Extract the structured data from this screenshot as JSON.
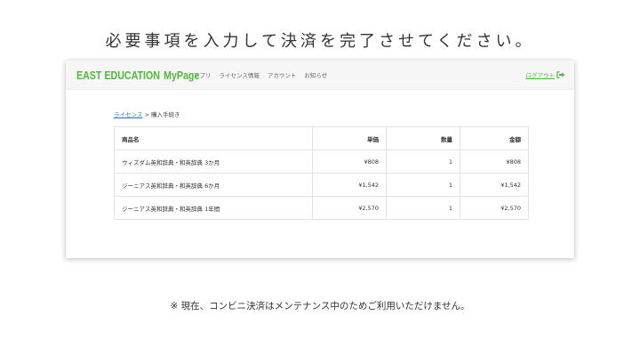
{
  "headline": "必要事項を入力して決済を完了させてください。",
  "header": {
    "brand_main": "EAST EDUCATION",
    "brand_sub": "MyPage",
    "nav": [
      "アプリ",
      "ライセンス情報",
      "アカウント",
      "お知らせ"
    ],
    "logout_label": "ログアウト",
    "logout_icon": "sign-out-icon",
    "brand_color": "#4dba3a"
  },
  "breadcrumb": {
    "link": "ライセンス",
    "separator": ">",
    "current": "購入手続き"
  },
  "table": {
    "headers": [
      "商品名",
      "単価",
      "数量",
      "金額"
    ],
    "rows": [
      [
        "ウィズダム英和辞典・和英辞典 3か月",
        "¥808",
        "1",
        "¥808"
      ],
      [
        "ジーニアス英和辞典・和英辞典 6か月",
        "¥1,542",
        "1",
        "¥1,542"
      ],
      [
        "ジーニアス英和辞典・和英辞典 1年間",
        "¥2,570",
        "1",
        "¥2,570"
      ]
    ]
  },
  "notice": "※ 現在、コンビニ決済はメンテナンス中のためご利用いただけません。"
}
